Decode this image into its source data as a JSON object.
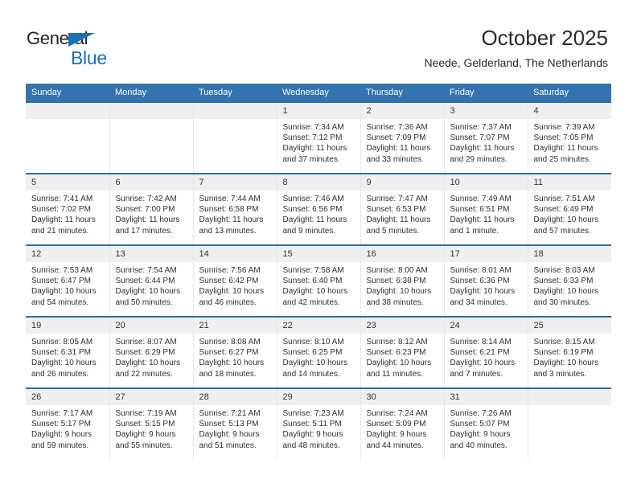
{
  "brand": {
    "name_part1": "General",
    "name_part2": "Blue",
    "flag_color": "#1a70b8",
    "icon": "flag-triangle-icon"
  },
  "header": {
    "month_title": "October 2025",
    "location": "Neede, Gelderland, The Netherlands"
  },
  "theme": {
    "header_blue": "#3572b0",
    "row_divider_blue": "#2e6da4",
    "daynum_band": "#efefef"
  },
  "weekday_headers": [
    "Sunday",
    "Monday",
    "Tuesday",
    "Wednesday",
    "Thursday",
    "Friday",
    "Saturday"
  ],
  "weeks": [
    [
      {
        "day": "",
        "empty": true,
        "sunrise": "",
        "sunset": "",
        "daylight_line1": "",
        "daylight_line2": ""
      },
      {
        "day": "",
        "empty": true,
        "sunrise": "",
        "sunset": "",
        "daylight_line1": "",
        "daylight_line2": ""
      },
      {
        "day": "",
        "empty": true,
        "sunrise": "",
        "sunset": "",
        "daylight_line1": "",
        "daylight_line2": ""
      },
      {
        "day": "1",
        "sunrise": "Sunrise: 7:34 AM",
        "sunset": "Sunset: 7:12 PM",
        "daylight_line1": "Daylight: 11 hours",
        "daylight_line2": "and 37 minutes."
      },
      {
        "day": "2",
        "sunrise": "Sunrise: 7:36 AM",
        "sunset": "Sunset: 7:09 PM",
        "daylight_line1": "Daylight: 11 hours",
        "daylight_line2": "and 33 minutes."
      },
      {
        "day": "3",
        "sunrise": "Sunrise: 7:37 AM",
        "sunset": "Sunset: 7:07 PM",
        "daylight_line1": "Daylight: 11 hours",
        "daylight_line2": "and 29 minutes."
      },
      {
        "day": "4",
        "sunrise": "Sunrise: 7:39 AM",
        "sunset": "Sunset: 7:05 PM",
        "daylight_line1": "Daylight: 11 hours",
        "daylight_line2": "and 25 minutes."
      }
    ],
    [
      {
        "day": "5",
        "sunrise": "Sunrise: 7:41 AM",
        "sunset": "Sunset: 7:02 PM",
        "daylight_line1": "Daylight: 11 hours",
        "daylight_line2": "and 21 minutes."
      },
      {
        "day": "6",
        "sunrise": "Sunrise: 7:42 AM",
        "sunset": "Sunset: 7:00 PM",
        "daylight_line1": "Daylight: 11 hours",
        "daylight_line2": "and 17 minutes."
      },
      {
        "day": "7",
        "sunrise": "Sunrise: 7:44 AM",
        "sunset": "Sunset: 6:58 PM",
        "daylight_line1": "Daylight: 11 hours",
        "daylight_line2": "and 13 minutes."
      },
      {
        "day": "8",
        "sunrise": "Sunrise: 7:46 AM",
        "sunset": "Sunset: 6:56 PM",
        "daylight_line1": "Daylight: 11 hours",
        "daylight_line2": "and 9 minutes."
      },
      {
        "day": "9",
        "sunrise": "Sunrise: 7:47 AM",
        "sunset": "Sunset: 6:53 PM",
        "daylight_line1": "Daylight: 11 hours",
        "daylight_line2": "and 5 minutes."
      },
      {
        "day": "10",
        "sunrise": "Sunrise: 7:49 AM",
        "sunset": "Sunset: 6:51 PM",
        "daylight_line1": "Daylight: 11 hours",
        "daylight_line2": "and 1 minute."
      },
      {
        "day": "11",
        "sunrise": "Sunrise: 7:51 AM",
        "sunset": "Sunset: 6:49 PM",
        "daylight_line1": "Daylight: 10 hours",
        "daylight_line2": "and 57 minutes."
      }
    ],
    [
      {
        "day": "12",
        "sunrise": "Sunrise: 7:53 AM",
        "sunset": "Sunset: 6:47 PM",
        "daylight_line1": "Daylight: 10 hours",
        "daylight_line2": "and 54 minutes."
      },
      {
        "day": "13",
        "sunrise": "Sunrise: 7:54 AM",
        "sunset": "Sunset: 6:44 PM",
        "daylight_line1": "Daylight: 10 hours",
        "daylight_line2": "and 50 minutes."
      },
      {
        "day": "14",
        "sunrise": "Sunrise: 7:56 AM",
        "sunset": "Sunset: 6:42 PM",
        "daylight_line1": "Daylight: 10 hours",
        "daylight_line2": "and 46 minutes."
      },
      {
        "day": "15",
        "sunrise": "Sunrise: 7:58 AM",
        "sunset": "Sunset: 6:40 PM",
        "daylight_line1": "Daylight: 10 hours",
        "daylight_line2": "and 42 minutes."
      },
      {
        "day": "16",
        "sunrise": "Sunrise: 8:00 AM",
        "sunset": "Sunset: 6:38 PM",
        "daylight_line1": "Daylight: 10 hours",
        "daylight_line2": "and 38 minutes."
      },
      {
        "day": "17",
        "sunrise": "Sunrise: 8:01 AM",
        "sunset": "Sunset: 6:36 PM",
        "daylight_line1": "Daylight: 10 hours",
        "daylight_line2": "and 34 minutes."
      },
      {
        "day": "18",
        "sunrise": "Sunrise: 8:03 AM",
        "sunset": "Sunset: 6:33 PM",
        "daylight_line1": "Daylight: 10 hours",
        "daylight_line2": "and 30 minutes."
      }
    ],
    [
      {
        "day": "19",
        "sunrise": "Sunrise: 8:05 AM",
        "sunset": "Sunset: 6:31 PM",
        "daylight_line1": "Daylight: 10 hours",
        "daylight_line2": "and 26 minutes."
      },
      {
        "day": "20",
        "sunrise": "Sunrise: 8:07 AM",
        "sunset": "Sunset: 6:29 PM",
        "daylight_line1": "Daylight: 10 hours",
        "daylight_line2": "and 22 minutes."
      },
      {
        "day": "21",
        "sunrise": "Sunrise: 8:08 AM",
        "sunset": "Sunset: 6:27 PM",
        "daylight_line1": "Daylight: 10 hours",
        "daylight_line2": "and 18 minutes."
      },
      {
        "day": "22",
        "sunrise": "Sunrise: 8:10 AM",
        "sunset": "Sunset: 6:25 PM",
        "daylight_line1": "Daylight: 10 hours",
        "daylight_line2": "and 14 minutes."
      },
      {
        "day": "23",
        "sunrise": "Sunrise: 8:12 AM",
        "sunset": "Sunset: 6:23 PM",
        "daylight_line1": "Daylight: 10 hours",
        "daylight_line2": "and 11 minutes."
      },
      {
        "day": "24",
        "sunrise": "Sunrise: 8:14 AM",
        "sunset": "Sunset: 6:21 PM",
        "daylight_line1": "Daylight: 10 hours",
        "daylight_line2": "and 7 minutes."
      },
      {
        "day": "25",
        "sunrise": "Sunrise: 8:15 AM",
        "sunset": "Sunset: 6:19 PM",
        "daylight_line1": "Daylight: 10 hours",
        "daylight_line2": "and 3 minutes."
      }
    ],
    [
      {
        "day": "26",
        "sunrise": "Sunrise: 7:17 AM",
        "sunset": "Sunset: 5:17 PM",
        "daylight_line1": "Daylight: 9 hours",
        "daylight_line2": "and 59 minutes."
      },
      {
        "day": "27",
        "sunrise": "Sunrise: 7:19 AM",
        "sunset": "Sunset: 5:15 PM",
        "daylight_line1": "Daylight: 9 hours",
        "daylight_line2": "and 55 minutes."
      },
      {
        "day": "28",
        "sunrise": "Sunrise: 7:21 AM",
        "sunset": "Sunset: 5:13 PM",
        "daylight_line1": "Daylight: 9 hours",
        "daylight_line2": "and 51 minutes."
      },
      {
        "day": "29",
        "sunrise": "Sunrise: 7:23 AM",
        "sunset": "Sunset: 5:11 PM",
        "daylight_line1": "Daylight: 9 hours",
        "daylight_line2": "and 48 minutes."
      },
      {
        "day": "30",
        "sunrise": "Sunrise: 7:24 AM",
        "sunset": "Sunset: 5:09 PM",
        "daylight_line1": "Daylight: 9 hours",
        "daylight_line2": "and 44 minutes."
      },
      {
        "day": "31",
        "sunrise": "Sunrise: 7:26 AM",
        "sunset": "Sunset: 5:07 PM",
        "daylight_line1": "Daylight: 9 hours",
        "daylight_line2": "and 40 minutes."
      },
      {
        "day": "",
        "empty": true,
        "sunrise": "",
        "sunset": "",
        "daylight_line1": "",
        "daylight_line2": ""
      }
    ]
  ]
}
